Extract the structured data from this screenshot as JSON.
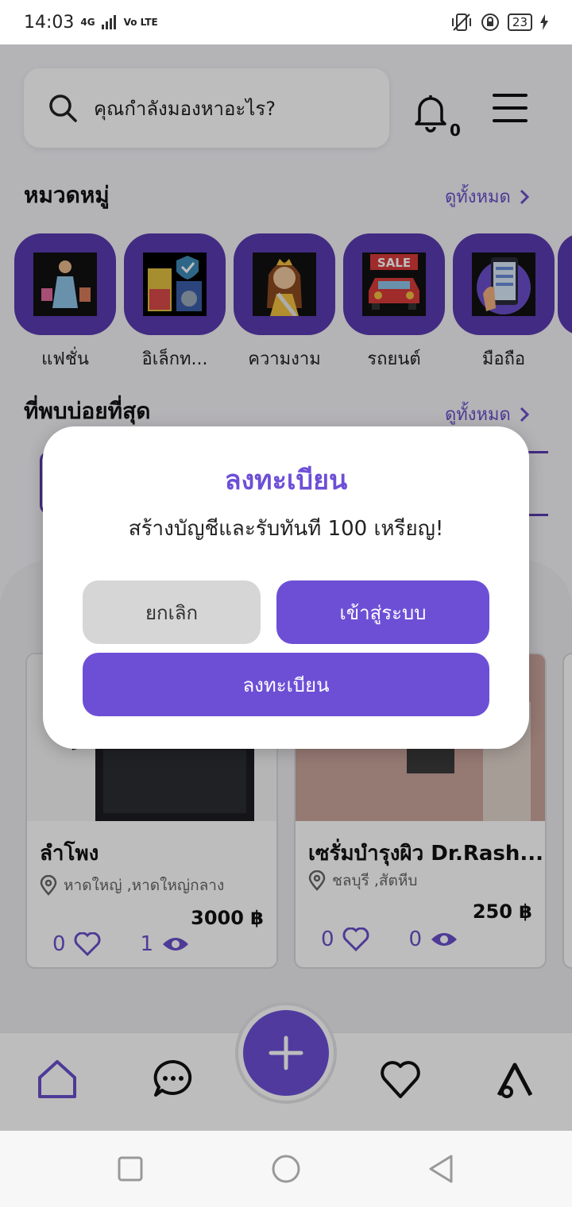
{
  "status": {
    "time": "14:03",
    "network": "4G",
    "volte": "Vo LTE",
    "battery": "23"
  },
  "search": {
    "placeholder": "คุณกำลังมองหาอะไร?"
  },
  "notifications": {
    "count": "0"
  },
  "categories": {
    "title": "หมวดหมู่",
    "see_all": "ดูทั้งหมด",
    "items": [
      {
        "label": "แฟชั่น"
      },
      {
        "label": "อิเล็กท..."
      },
      {
        "label": "ความงาม"
      },
      {
        "label": "รถยนต์"
      },
      {
        "label": "มือถือ"
      }
    ]
  },
  "frequent": {
    "title": "ที่พบบ่อยที่สุด",
    "see_all": "ดูทั้งหมด"
  },
  "products": [
    {
      "title": "ลำโพง",
      "location": "หาดใหญ่ ,หาดใหญ่กลาง",
      "price": "3000 ฿",
      "likes": "0",
      "views": "1"
    },
    {
      "title": "เซรั่มบำรุงผิว Dr.Rash...",
      "location": "ชลบุรี ,สัตหีบ",
      "price": "250 ฿",
      "likes": "0",
      "views": "0"
    }
  ],
  "dialog": {
    "title": "ลงทะเบียน",
    "message": "สร้างบัญชีและรับทันที 100 เหรียญ!",
    "cancel": "ยกเลิก",
    "login": "เข้าสู่ระบบ",
    "register": "ลงทะเบียน"
  },
  "colors": {
    "accent": "#6d4fd6",
    "category_bg": "#5a3ab0"
  }
}
